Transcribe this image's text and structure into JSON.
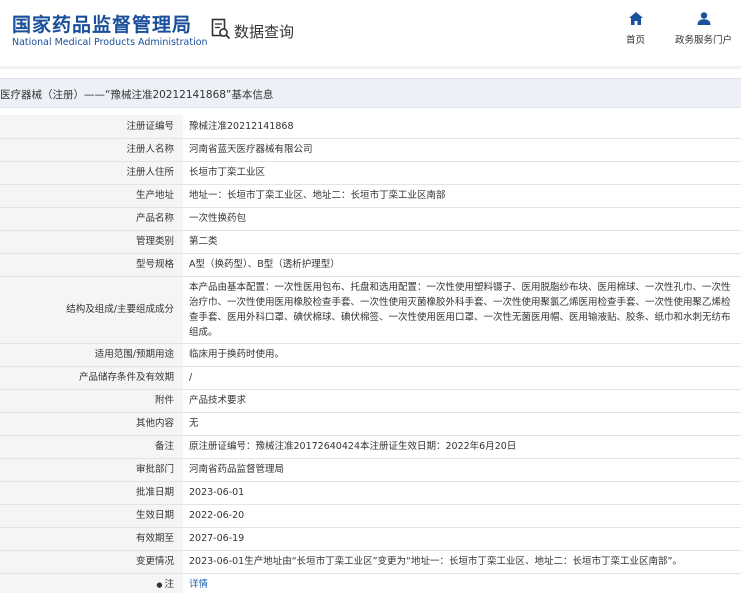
{
  "header": {
    "logo_cn": "国家药品监督管理局",
    "logo_en": "National Medical Products Administration",
    "search_title": "数据查询",
    "nav": [
      {
        "label": "首页",
        "icon": "home-icon"
      },
      {
        "label": "政务服务门户",
        "icon": "user-icon"
      }
    ],
    "accent_color": "#1a4f9c"
  },
  "page_title": "医疗器械（注册）——“豫械注准20212141868”基本信息",
  "rows": [
    {
      "label": "注册证编号",
      "value": "豫械注准20212141868"
    },
    {
      "label": "注册人名称",
      "value": "河南省蓝天医疗器械有限公司"
    },
    {
      "label": "注册人住所",
      "value": "长垣市丁栾工业区"
    },
    {
      "label": "生产地址",
      "value": "地址一：长垣市丁栾工业区、地址二：长垣市丁栾工业区南部"
    },
    {
      "label": "产品名称",
      "value": "一次性换药包"
    },
    {
      "label": "管理类别",
      "value": "第二类"
    },
    {
      "label": "型号规格",
      "value": "A型（换药型）、B型（透析护理型）"
    },
    {
      "label": "结构及组成/主要组成成分",
      "value": "本产品由基本配置：一次性医用包布、托盘和选用配置：一次性使用塑料镊子、医用脱脂纱布块、医用棉球、一次性孔巾、一次性治疗巾、一次性使用医用橡胶检查手套、一次性使用灭菌橡胶外科手套、一次性使用聚氯乙烯医用检查手套、一次性使用聚乙烯检查手套、医用外科口罩、碘伏棉球、碘伏棉签、一次性使用医用口罩、一次性无菌医用帽、医用输液贴、胶条、纸巾和水刺无纺布组成。"
    },
    {
      "label": "适用范围/预期用途",
      "value": "临床用于换药时使用。"
    },
    {
      "label": "产品储存条件及有效期",
      "value": "/"
    },
    {
      "label": "附件",
      "value": "产品技术要求"
    },
    {
      "label": "其他内容",
      "value": "无"
    },
    {
      "label": "备注",
      "value": "原注册证编号：豫械注准20172640424本注册证生效日期：2022年6月20日"
    },
    {
      "label": "审批部门",
      "value": "河南省药品监督管理局"
    },
    {
      "label": "批准日期",
      "value": "2023-06-01"
    },
    {
      "label": "生效日期",
      "value": "2022-06-20"
    },
    {
      "label": "有效期至",
      "value": "2027-06-19"
    },
    {
      "label": "变更情况",
      "value": "2023-06-01生产地址由“长垣市丁栾工业区”变更为“地址一：长垣市丁栾工业区、地址二：长垣市丁栾工业区南部”。"
    }
  ],
  "note_row": {
    "label": "注",
    "link": "详情",
    "icon": "pin-icon"
  }
}
